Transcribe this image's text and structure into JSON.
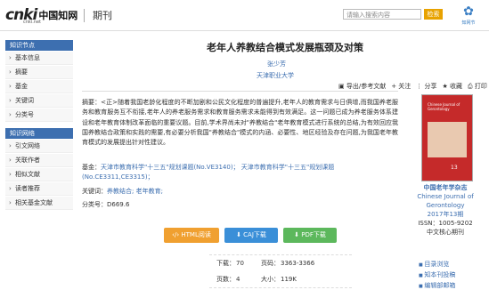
{
  "header": {
    "logo_text": "cnki",
    "logo_cn": "中国知网",
    "logo_url": "cnki.net",
    "section": "期刊",
    "search_placeholder": "请输入搜索内容",
    "search_button": "检索",
    "brand_text": "知网节"
  },
  "sidebar": {
    "group1": "知识节点",
    "group1_items": [
      "基本信息",
      "摘要",
      "基金",
      "关键词",
      "分类号"
    ],
    "group2": "知识网络",
    "group2_items": [
      "引文网络",
      "关联作者",
      "相似文献",
      "读者推荐",
      "相关基金文献"
    ]
  },
  "article": {
    "title": "老年人养教结合模式发展瓶颈及对策",
    "author": "张少芳",
    "institution": "天津职业大学",
    "toolbar": [
      "导出/参考文献",
      "关注",
      "分享",
      "收藏",
      "打印"
    ],
    "abstract_label": "摘要：",
    "abstract": "<正>随着我国老龄化程度的不断加剧和公民文化程度的普遍提升,老年人的教育需求与日俱增,而我国养老服务和教育服务互不衔接,老年人的养老服务需求和教育服务需求未能得到有效满足。这一问题已成为养老服务体系建设和老年教育体制改革面临的重要议题。目前,学术界尚未对\"养教结合\"老年教育模式进行系统的总结,为有效回应我国养教结合政策和实践的需要,有必要分析我国\"养教结合\"模式的内涵、必要性、地区经验及存在问题,为我国老年教育模式的发展提出针对性建议。",
    "fund_label": "基金：",
    "fund": "天津市教育科学\"十三五\"规划课题(No.VE3140)； 天津市教育科学\"十三五\"规划课题(No.CE3311,CE3315)；",
    "keyword_label": "关键词：",
    "keywords": "养教结合; 老年教育;",
    "class_label": "分类号：",
    "class_code": "D669.6"
  },
  "buttons": {
    "html": "HTML阅读",
    "caj": "CAJ下载",
    "pdf": "PDF下载"
  },
  "stats": {
    "downloads_label": "下载：",
    "downloads": "70",
    "pages_label": "页码：",
    "pages": "3363-3366",
    "page_count_label": "页数：",
    "page_count": "4",
    "size_label": "大小：",
    "size": "119K"
  },
  "journal": {
    "name": "中国老年学杂志",
    "en_name": "Chinese Journal of Gerontology",
    "issue": "2017年13期",
    "issn": "ISSN：1005-9202",
    "core": "中文核心期刊",
    "cover_title": "Chinese Journal of Gerontology",
    "cover_num": "13"
  },
  "right_links": [
    "目录浏览",
    "知本刊投稿",
    "编辑部邮箱"
  ],
  "colors": {
    "accent": "#3d6fb0",
    "html_btn": "#f0a030",
    "caj_btn": "#3a8fd8",
    "pdf_btn": "#5cb85c"
  }
}
